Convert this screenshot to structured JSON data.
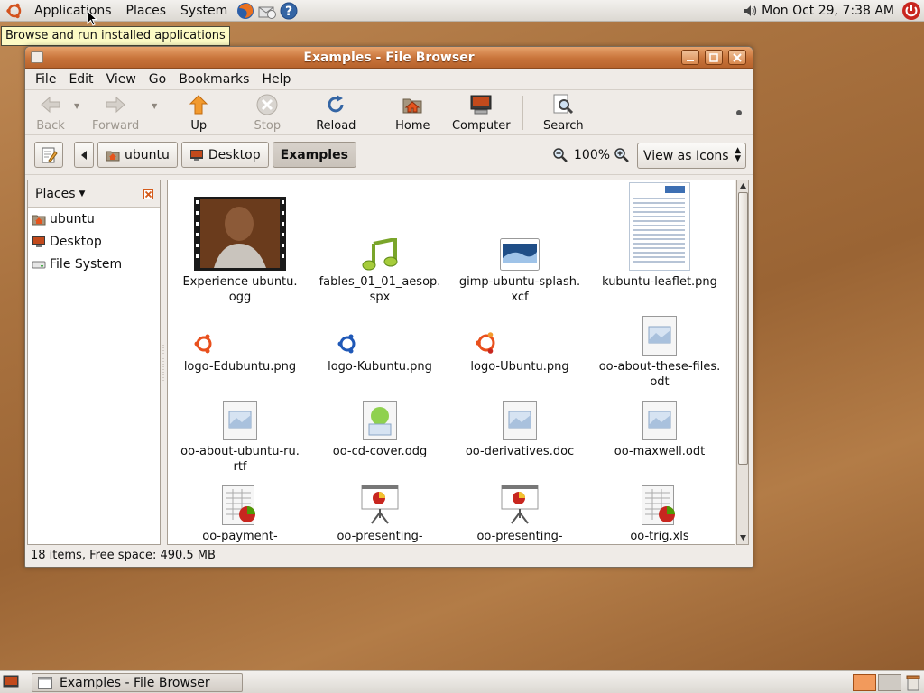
{
  "top_panel": {
    "menus": [
      "Applications",
      "Places",
      "System"
    ],
    "clock": "Mon Oct 29,  7:38 AM",
    "tooltip": "Browse and run installed applications"
  },
  "window": {
    "title": "Examples - File Browser",
    "menubar": [
      "File",
      "Edit",
      "View",
      "Go",
      "Bookmarks",
      "Help"
    ],
    "toolbar": {
      "back": "Back",
      "forward": "Forward",
      "up": "Up",
      "stop": "Stop",
      "reload": "Reload",
      "home": "Home",
      "computer": "Computer",
      "search": "Search"
    },
    "path": [
      "ubuntu",
      "Desktop",
      "Examples"
    ],
    "zoom": "100%",
    "view_mode": "View as Icons",
    "sidebar": {
      "title": "Places",
      "items": [
        "ubuntu",
        "Desktop",
        "File System"
      ]
    },
    "files": [
      {
        "name": "Experience ubuntu.\nogg"
      },
      {
        "name": "fables_01_01_aesop.\nspx"
      },
      {
        "name": "gimp-ubuntu-splash.\nxcf"
      },
      {
        "name": "kubuntu-leaflet.png"
      },
      {
        "name": "logo-Edubuntu.png",
        "logo": "edubuntu"
      },
      {
        "name": "logo-Kubuntu.png",
        "logo": "kubuntu"
      },
      {
        "name": "logo-Ubuntu.png",
        "logo": "ubuntu"
      },
      {
        "name": "oo-about-these-files.\nodt"
      },
      {
        "name": "oo-about-ubuntu-ru.\nrtf"
      },
      {
        "name": "oo-cd-cover.odg"
      },
      {
        "name": "oo-derivatives.doc"
      },
      {
        "name": "oo-maxwell.odt"
      },
      {
        "name": "oo-payment-"
      },
      {
        "name": "oo-presenting-"
      },
      {
        "name": "oo-presenting-"
      },
      {
        "name": "oo-trig.xls"
      }
    ],
    "status": "18 items, Free space: 490.5 MB"
  },
  "bottom_panel": {
    "task": "Examples - File Browser"
  }
}
